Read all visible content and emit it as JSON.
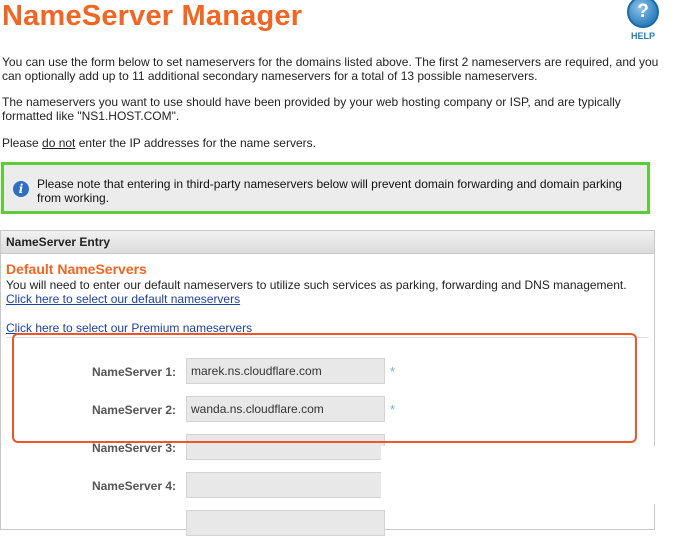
{
  "header": {
    "title": "NameServer Manager",
    "help_icon": "?",
    "help_label": "HELP"
  },
  "intro": {
    "p1": "You can use the form below to set nameservers for the domains listed above. The first 2 nameservers are required, and you can optionally add up to 11 additional secondary nameservers for a total of 13 possible nameservers.",
    "p2": "The nameservers you want to use should have been provided by your web hosting company or ISP, and are typically formatted like \"NS1.HOST.COM\".",
    "p3_before": "Please ",
    "p3_underline": "do not",
    "p3_after": " enter the IP addresses for the name servers."
  },
  "notice": {
    "icon": "i",
    "text": "Please note that entering in third-party nameservers below will prevent domain forwarding and domain parking from working."
  },
  "panel": {
    "header": "NameServer Entry",
    "section_title": "Default NameServers",
    "section_desc": "You will need to enter our default nameservers to utilize such services as parking, forwarding and DNS management.",
    "default_link": "Click here to select our default nameservers",
    "premium_link": "Click here to select our Premium nameservers"
  },
  "nameservers": [
    {
      "label": "NameServer 1:",
      "value": "marek.ns.cloudflare.com",
      "required_mark": "*"
    },
    {
      "label": "NameServer 2:",
      "value": "wanda.ns.cloudflare.com",
      "required_mark": "*"
    },
    {
      "label": "NameServer 3:",
      "value": "",
      "required_mark": ""
    },
    {
      "label": "NameServer 4:",
      "value": "",
      "required_mark": ""
    },
    {
      "label": "",
      "value": "",
      "required_mark": ""
    }
  ],
  "colors": {
    "title": "#f26522",
    "notice_border": "#5ccc3a",
    "highlight_border": "#f0552a",
    "link": "#1a3fa8"
  }
}
